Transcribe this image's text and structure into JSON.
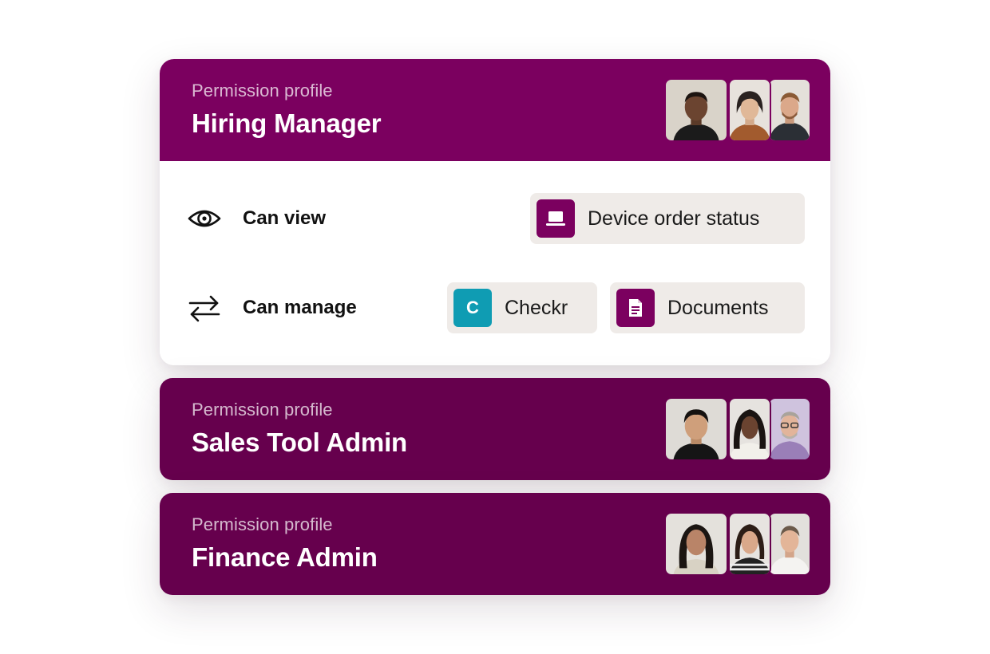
{
  "colors": {
    "brand_plum": "#7b005f",
    "plum_dark": "#66004d",
    "chip_bg": "#efebe8",
    "checkr_teal": "#0f9cb3"
  },
  "profiles": [
    {
      "eyebrow": "Permission profile",
      "name": "Hiring Manager",
      "expanded": true,
      "avatars": [
        "avatar-man-dark",
        "avatar-woman-older",
        "avatar-man-beard"
      ],
      "permissions": [
        {
          "label": "Can view",
          "icon": "eye-icon",
          "items": [
            {
              "label": "Device order status",
              "icon": "laptop-icon"
            }
          ]
        },
        {
          "label": "Can manage",
          "icon": "arrows-swap-icon",
          "items": [
            {
              "label": "Checkr",
              "icon": "checkr-logo-icon",
              "badge": "C"
            },
            {
              "label": "Documents",
              "icon": "document-icon"
            }
          ]
        }
      ]
    },
    {
      "eyebrow": "Permission profile",
      "name": "Sales Tool Admin",
      "expanded": false,
      "avatars": [
        "avatar-man-asian",
        "avatar-woman-braids",
        "avatar-man-glasses"
      ]
    },
    {
      "eyebrow": "Permission profile",
      "name": "Finance Admin",
      "expanded": false,
      "avatars": [
        "avatar-woman-longhair",
        "avatar-woman-smile",
        "avatar-man-gray"
      ]
    }
  ]
}
